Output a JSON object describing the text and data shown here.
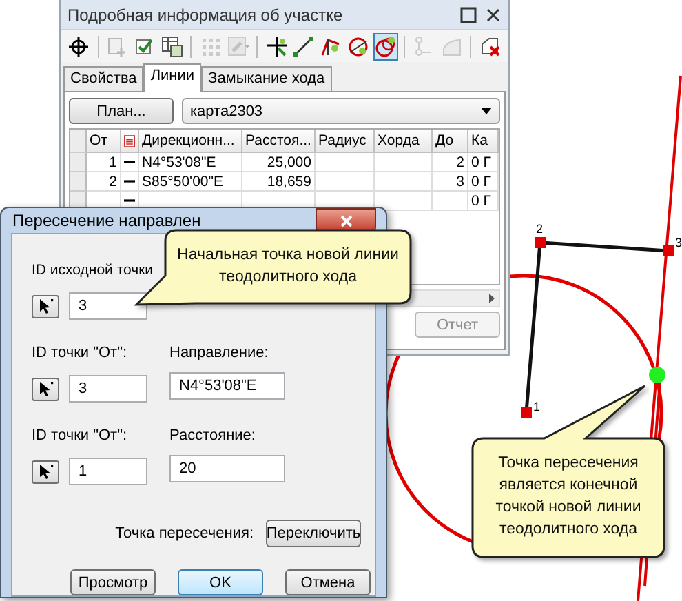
{
  "map": {
    "points": [
      {
        "label": "1"
      },
      {
        "label": "2"
      },
      {
        "label": "3"
      }
    ]
  },
  "parcel_window": {
    "title": "Подробная информация об участке",
    "toolbar": [
      {
        "kind": "target",
        "disabled": false,
        "pressed": false
      },
      {
        "kind": "sep"
      },
      {
        "kind": "add-row",
        "disabled": true,
        "pressed": false
      },
      {
        "kind": "check",
        "disabled": false,
        "pressed": false
      },
      {
        "kind": "table-edit",
        "disabled": false,
        "pressed": false
      },
      {
        "kind": "sep"
      },
      {
        "kind": "grid-points",
        "disabled": true,
        "pressed": false
      },
      {
        "kind": "wrench",
        "disabled": true,
        "pressed": false
      },
      {
        "kind": "sep"
      },
      {
        "kind": "point-line",
        "disabled": false,
        "pressed": false
      },
      {
        "kind": "line",
        "disabled": false,
        "pressed": false
      },
      {
        "kind": "angle",
        "disabled": false,
        "pressed": false
      },
      {
        "kind": "circle-point",
        "disabled": false,
        "pressed": false
      },
      {
        "kind": "circles",
        "disabled": false,
        "pressed": true
      },
      {
        "kind": "sep"
      },
      {
        "kind": "nodes",
        "disabled": true,
        "pressed": false
      },
      {
        "kind": "curve",
        "disabled": true,
        "pressed": false
      },
      {
        "kind": "sep"
      },
      {
        "kind": "delete",
        "disabled": false,
        "pressed": false
      }
    ],
    "tabs": [
      {
        "label": "Свойства",
        "selected": false
      },
      {
        "label": "Линии",
        "selected": true
      },
      {
        "label": "Замыкание хода",
        "selected": false
      }
    ],
    "plan_button": "План...",
    "plan_select": "карта2303",
    "table": {
      "columns": [
        {
          "kind": "text",
          "label": "От"
        },
        {
          "kind": "icon"
        },
        {
          "kind": "text",
          "label": "Дирекционн..."
        },
        {
          "kind": "text",
          "label": "Расстоя..."
        },
        {
          "kind": "text",
          "label": "Радиус"
        },
        {
          "kind": "text",
          "label": "Хорда"
        },
        {
          "kind": "text",
          "label": "До"
        },
        {
          "kind": "text",
          "label": "Ка"
        }
      ],
      "rows": [
        {
          "from": "1",
          "bearing": "N4°53'08\"E",
          "distance": "25,000",
          "to": "2",
          "column_8": "0 Г"
        },
        {
          "from": "2",
          "bearing": "S85°50'00\"E",
          "distance": "18,659",
          "to": "3",
          "column_8": "0 Г"
        },
        {
          "column_8": "0 Г"
        }
      ]
    },
    "report_button": {
      "label": "Отчет",
      "disabled": true
    }
  },
  "dialog": {
    "title": "Пересечение направлен",
    "start_point": {
      "label": "ID исходной точки",
      "value": "3"
    },
    "direction_row": {
      "from_label": "ID точки \"От\":",
      "from_value": "3",
      "label": "Направление:",
      "value": "N4°53'08\"E"
    },
    "distance_row": {
      "from_label": "ID точки \"От\":",
      "from_value": "1",
      "label": "Расстояние:",
      "value": "20"
    },
    "intersection_label": "Точка пересечения:",
    "switch_button": "Переключить",
    "buttons": [
      {
        "label": "Просмотр",
        "default": false
      },
      {
        "label": "OK",
        "default": true
      },
      {
        "label": "Отмена",
        "default": false
      }
    ]
  },
  "callouts": [
    {
      "text": "Начальная точка новой линии теодолитного хода"
    },
    {
      "text": "Точка пересечения является конечной точкой новой линии теодолитного хода"
    }
  ]
}
